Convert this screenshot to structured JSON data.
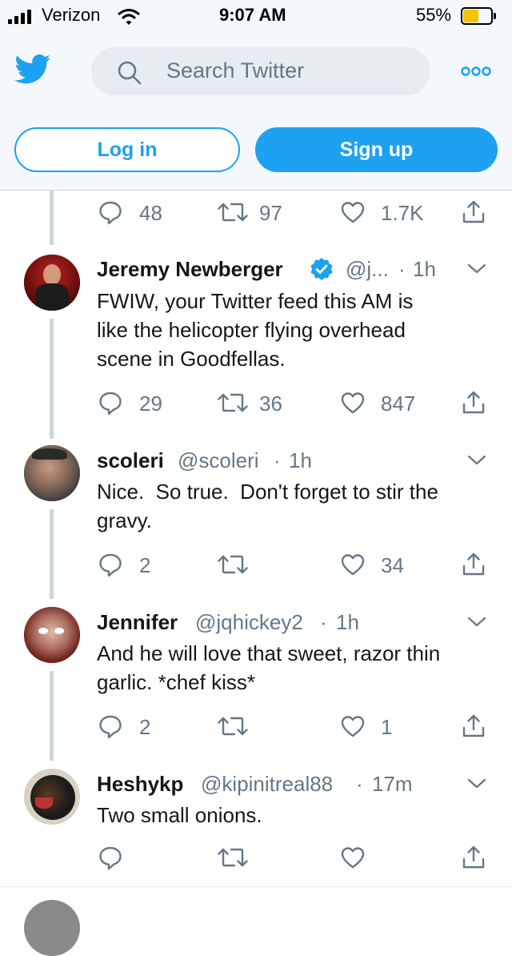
{
  "status_bar": {
    "carrier": "Verizon",
    "time": "9:07 AM",
    "battery": "55%",
    "battery_level": 0.55
  },
  "header": {
    "search_placeholder": "Search Twitter",
    "login_label": "Log in",
    "signup_label": "Sign up"
  },
  "top_actions": {
    "replies": "48",
    "retweets": "97",
    "likes": "1.7K"
  },
  "tweets": [
    {
      "name": "Jeremy Newberger",
      "verified": true,
      "handle": "@j...",
      "time": "1h",
      "lines": [
        "FWIW, your Twitter feed this AM is",
        "like the helicopter flying overhead",
        "scene in Goodfellas."
      ],
      "replies": "29",
      "retweets": "36",
      "likes": "847"
    },
    {
      "name": "scoleri",
      "handle": "@scoleri",
      "time": "1h",
      "lines": [
        "Nice.  So true.  Don't forget to stir the",
        "gravy."
      ],
      "replies": "2",
      "retweets": "",
      "likes": "34"
    },
    {
      "name": "Jennifer",
      "handle": "@jqhickey2",
      "time": "1h",
      "lines": [
        "And he will love that sweet, razor thin",
        "garlic. *chef kiss*"
      ],
      "replies": "2",
      "retweets": "",
      "likes": "1"
    },
    {
      "name": "Heshykp",
      "handle": "@kipinitreal88",
      "time": "17m",
      "lines": [
        "Two small onions."
      ],
      "replies": "",
      "retweets": "",
      "likes": ""
    }
  ],
  "colors": {
    "brand": "#1da1f2",
    "text": "#14171a",
    "muted": "#657786",
    "thread_line": "#ccd6dd",
    "battery": "#f5c400"
  }
}
